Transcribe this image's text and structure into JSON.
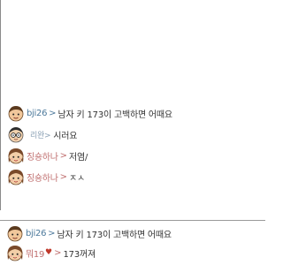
{
  "chat_top": [
    {
      "avatar": "boy-avatar-icon",
      "nick": "bji26",
      "sep": ">",
      "text": "남자 키 173이 고백하면 어때요"
    },
    {
      "avatar": "glasses-avatar-icon",
      "nick": "리완>",
      "sep": "",
      "text": "시러요"
    },
    {
      "avatar": "girl-avatar-icon",
      "nick": "징숑하나",
      "sep": ">",
      "text": "저염/"
    },
    {
      "avatar": "girl-avatar-icon",
      "nick": "징숑하나",
      "sep": ">",
      "text": "ㅈㅅ"
    }
  ],
  "chat_bottom": [
    {
      "avatar": "boy-avatar-icon",
      "nick": "bji26",
      "sep": ">",
      "text": "남자 키 173이 고백하면 어때요"
    },
    {
      "avatar": "girl-avatar-icon",
      "nick": "뭐19",
      "heart": "♥",
      "sep": ">",
      "text": "173꺼져"
    }
  ]
}
